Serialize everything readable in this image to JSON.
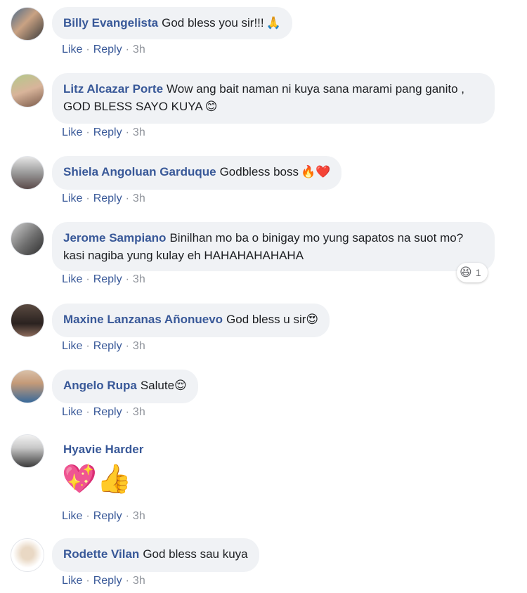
{
  "comments": [
    {
      "name": "Billy Evangelista",
      "text": "God bless you sir!!!",
      "emoji": "🙏",
      "like": "Like",
      "reply": "Reply",
      "time": "3h"
    },
    {
      "name": "Litz Alcazar Porte",
      "text": "Wow ang bait naman ni kuya sana marami pang ganito , GOD BLESS SAYO KUYA",
      "emoji": "😊",
      "like": "Like",
      "reply": "Reply",
      "time": "3h"
    },
    {
      "name": "Shiela Angoluan Garduque",
      "text": "Godbless boss",
      "emoji": "🔥❤️",
      "like": "Like",
      "reply": "Reply",
      "time": "3h"
    },
    {
      "name": "Jerome Sampiano",
      "text": "Binilhan mo ba o binigay mo yung sapatos na suot mo? kasi nagiba yung kulay eh HAHAHAHAHAHA",
      "like": "Like",
      "reply": "Reply",
      "time": "3h",
      "reaction_emoji": "😆",
      "reaction_count": "1"
    },
    {
      "name": "Maxine Lanzanas Añonuevo",
      "text": "God bless u sir",
      "emoji": "😍",
      "like": "Like",
      "reply": "Reply",
      "time": "3h"
    },
    {
      "name": "Angelo Rupa",
      "text": "Salute",
      "emoji": "😌",
      "like": "Like",
      "reply": "Reply",
      "time": "3h"
    },
    {
      "name": "Hyavie Harder",
      "emoji": "💖👍",
      "like": "Like",
      "reply": "Reply",
      "time": "3h"
    },
    {
      "name": "Rodette Vilan",
      "text": "God bless sau kuya",
      "like": "Like",
      "reply": "Reply",
      "time": "3h"
    }
  ],
  "colors": {
    "name": "#385898",
    "bubble": "#f0f2f5",
    "meta": "#90949c"
  }
}
